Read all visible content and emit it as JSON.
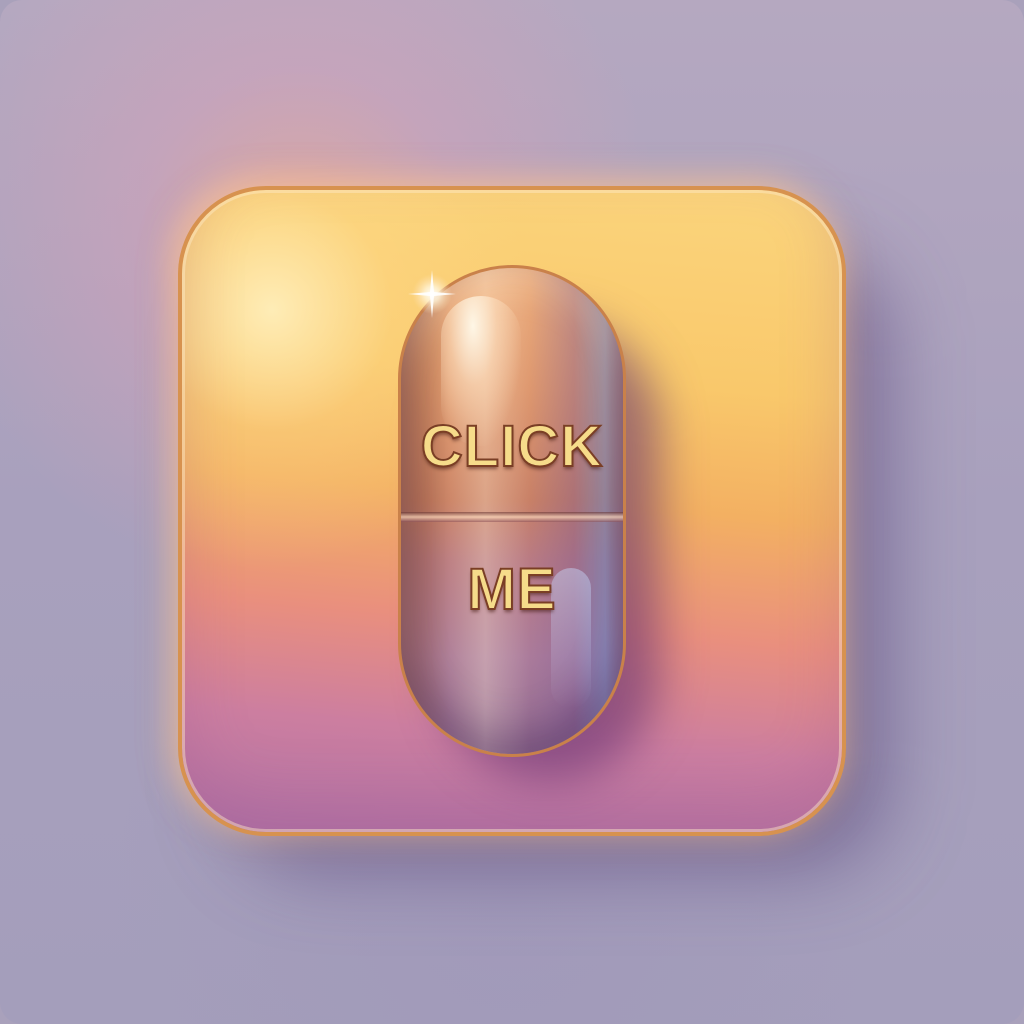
{
  "button": {
    "label_line1": "CLICK",
    "label_line2": "ME"
  },
  "colors": {
    "background": "#a9a1bb",
    "tile_top": "#fbd57d",
    "tile_bottom": "#b173a6",
    "tile_border": "#d7924f",
    "pill_text": "#f6dc8a",
    "pill_text_outline": "#7a3e25"
  },
  "icons": {
    "sparkle": "sparkle-icon"
  }
}
